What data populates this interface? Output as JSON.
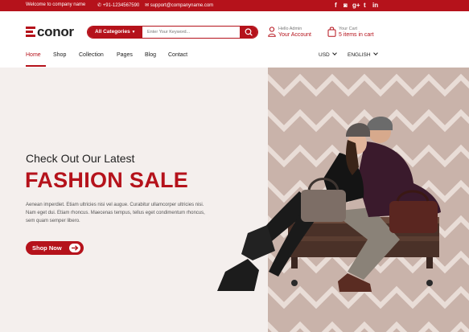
{
  "topbar": {
    "welcome": "Welcome to company name",
    "phone": "+91-1234567590",
    "email": "support@companyname.com",
    "social_icons": [
      "facebook-icon",
      "instagram-icon",
      "google-plus-icon",
      "twitter-icon",
      "linkedin-icon"
    ],
    "social_glyphs": [
      "f",
      "◙",
      "g+",
      "t",
      "in"
    ]
  },
  "header": {
    "logo": "conor",
    "search": {
      "category_label": "All Categories",
      "placeholder": "Enter Your Keyword..."
    },
    "account": {
      "greeting": "Hello Admin",
      "link": "Your Account"
    },
    "cart": {
      "label": "Your Cart",
      "count_text": "5 items in cart"
    }
  },
  "nav": {
    "items": [
      "Home",
      "Shop",
      "Collection",
      "Pages",
      "Blog",
      "Contact"
    ],
    "active": "Home",
    "currency": "USD",
    "language": "ENGLISH"
  },
  "hero": {
    "subtitle": "Check Out Our Latest",
    "title": "FASHION SALE",
    "description": "Aenean imperdiet. Etiam ultricies nisi vel augue. Curabitur ullamcorper ultricies nisi. Nam eget dui. Etiam rhoncus. Maecenas tempus, tellus eget condimentum rhoncus, sem quam semper libero.",
    "button": "Shop Now"
  },
  "colors": {
    "brand": "#b5121b",
    "hero_bg": "#f4efed",
    "pattern_bg": "#c9b3aa"
  }
}
